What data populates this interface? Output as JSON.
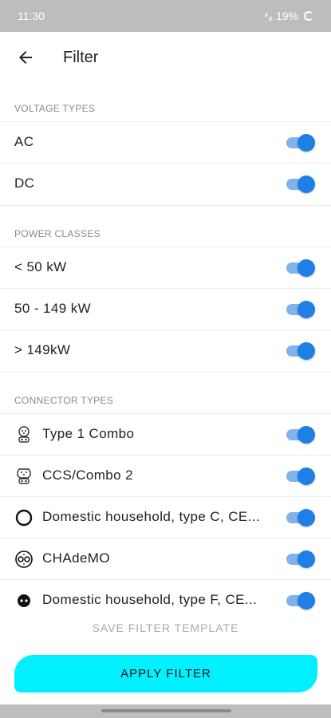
{
  "status": {
    "time": "11:30",
    "signal": "²₂",
    "battery": "19%"
  },
  "header": {
    "title": "Filter"
  },
  "sections": {
    "voltage": {
      "title": "VOLTAGE TYPES",
      "items": [
        {
          "label": "AC",
          "on": true
        },
        {
          "label": "DC",
          "on": true
        }
      ]
    },
    "power": {
      "title": "POWER CLASSES",
      "items": [
        {
          "label": "< 50 kW",
          "on": true
        },
        {
          "label": "50 - 149 kW",
          "on": true
        },
        {
          "label": "> 149kW",
          "on": true
        }
      ]
    },
    "connector": {
      "title": "CONNECTOR TYPES",
      "items": [
        {
          "label": "Type 1 Combo",
          "icon": "type1-combo-icon",
          "on": true
        },
        {
          "label": "CCS/Combo 2",
          "icon": "ccs-combo2-icon",
          "on": true
        },
        {
          "label": "Domestic household, type C, CE...",
          "icon": "domestic-type-c-icon",
          "on": true
        },
        {
          "label": "CHAdeMO",
          "icon": "chademo-icon",
          "on": true
        },
        {
          "label": "Domestic household, type F, CE...",
          "icon": "domestic-type-f-icon",
          "on": true
        }
      ]
    }
  },
  "actions": {
    "save_label": "SAVE FILTER TEMPLATE",
    "apply_label": "APPLY FILTER"
  },
  "colors": {
    "accent": "#1e7fe6",
    "apply": "#00f0ff"
  }
}
